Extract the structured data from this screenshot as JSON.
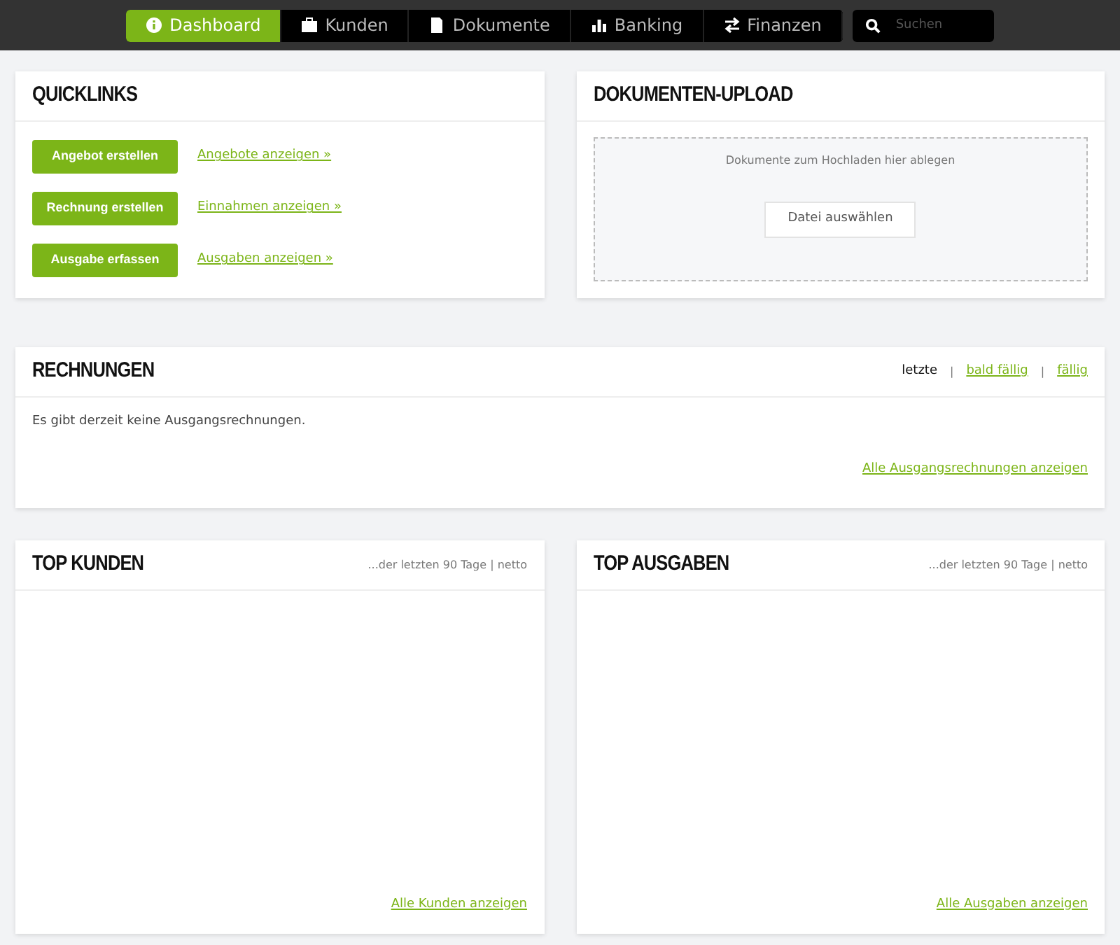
{
  "nav": {
    "tabs": [
      {
        "label": "Dashboard",
        "selected": true
      },
      {
        "label": "Kunden",
        "selected": false
      },
      {
        "label": "Dokumente",
        "selected": false
      },
      {
        "label": "Banking",
        "selected": false
      },
      {
        "label": "Finanzen",
        "selected": false
      }
    ],
    "search": {
      "placeholder": "Suchen"
    }
  },
  "quicklinks": {
    "title": "QUICKLINKS",
    "rows": [
      {
        "button": "Angebot erstellen",
        "link": "Angebote anzeigen »"
      },
      {
        "button": "Rechnung erstellen",
        "link": "Einnahmen anzeigen »"
      },
      {
        "button": "Ausgabe erfassen",
        "link": "Ausgaben anzeigen »"
      }
    ]
  },
  "upload": {
    "title": "DOKUMENTEN-UPLOAD",
    "hint": "Dokumente zum Hochladen hier ablegen",
    "button": "Datei auswählen"
  },
  "rechnungen": {
    "title": "RECHNUNGEN",
    "filters": [
      {
        "label": "letzte",
        "selected": true
      },
      {
        "label": "bald fällig",
        "selected": false
      },
      {
        "label": "fällig",
        "selected": false
      }
    ],
    "separator": "|",
    "message": "Es gibt derzeit keine Ausgangsrechnungen.",
    "link": "Alle Ausgangsrechnungen anzeigen"
  },
  "bottom_cards": [
    {
      "title": "TOP KUNDEN",
      "subtitle": "...der letzten 90 Tage | netto",
      "link": "Alle Kunden anzeigen"
    },
    {
      "title": "TOP AUSGABEN",
      "subtitle": "...der letzten 90 Tage | netto",
      "link": "Alle Ausgaben anzeigen"
    }
  ]
}
